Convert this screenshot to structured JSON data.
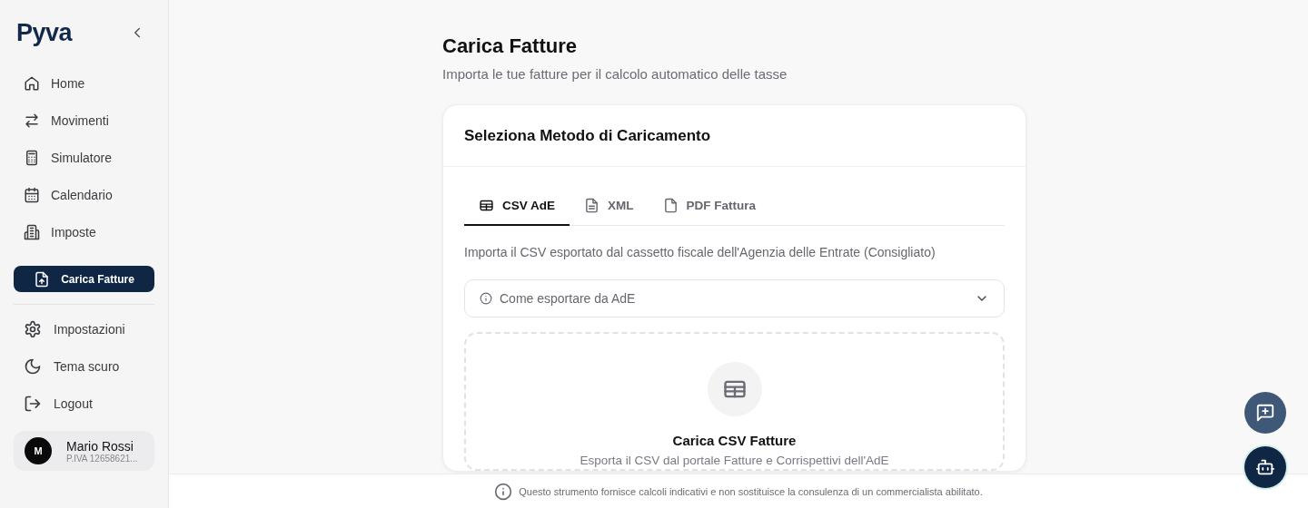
{
  "sidebar": {
    "logo": "Pyva",
    "nav": [
      {
        "label": "Home",
        "selected": false
      },
      {
        "label": "Movimenti",
        "selected": false
      },
      {
        "label": "Simulatore",
        "selected": false
      },
      {
        "label": "Calendario",
        "selected": false
      },
      {
        "label": "Imposte",
        "selected": false
      },
      {
        "label": "Carica Fatture",
        "selected": true
      }
    ],
    "menu": [
      {
        "label": "Impostazioni"
      },
      {
        "label": "Tema scuro"
      },
      {
        "label": "Logout"
      }
    ],
    "user": {
      "initial": "M",
      "name": "Mario Rossi",
      "vat": "P.IVA 12658621..."
    }
  },
  "page": {
    "title": "Carica Fatture",
    "subtitle": "Importa le tue fatture per il calcolo automatico delle tasse"
  },
  "card": {
    "title": "Seleziona Metodo di Caricamento",
    "tabs": [
      {
        "label": "CSV AdE",
        "selected": true
      },
      {
        "label": "XML",
        "selected": false
      },
      {
        "label": "PDF Fattura",
        "selected": false
      }
    ],
    "description": "Importa il CSV esportato dal cassetto fiscale dell'Agenzia delle Entrate (Consigliato)",
    "accordion": {
      "label": "Come esportare da AdE",
      "expanded": false
    },
    "dropzone": {
      "title": "Carica CSV Fatture",
      "text": "Esporta il CSV dal portale Fatture e Corrispettivi dell'AdE"
    }
  },
  "footer": {
    "disclaimer": "Questo strumento fornisce calcoli indicativi e non sostituisce la consulenza di un commercialista abilitato."
  }
}
